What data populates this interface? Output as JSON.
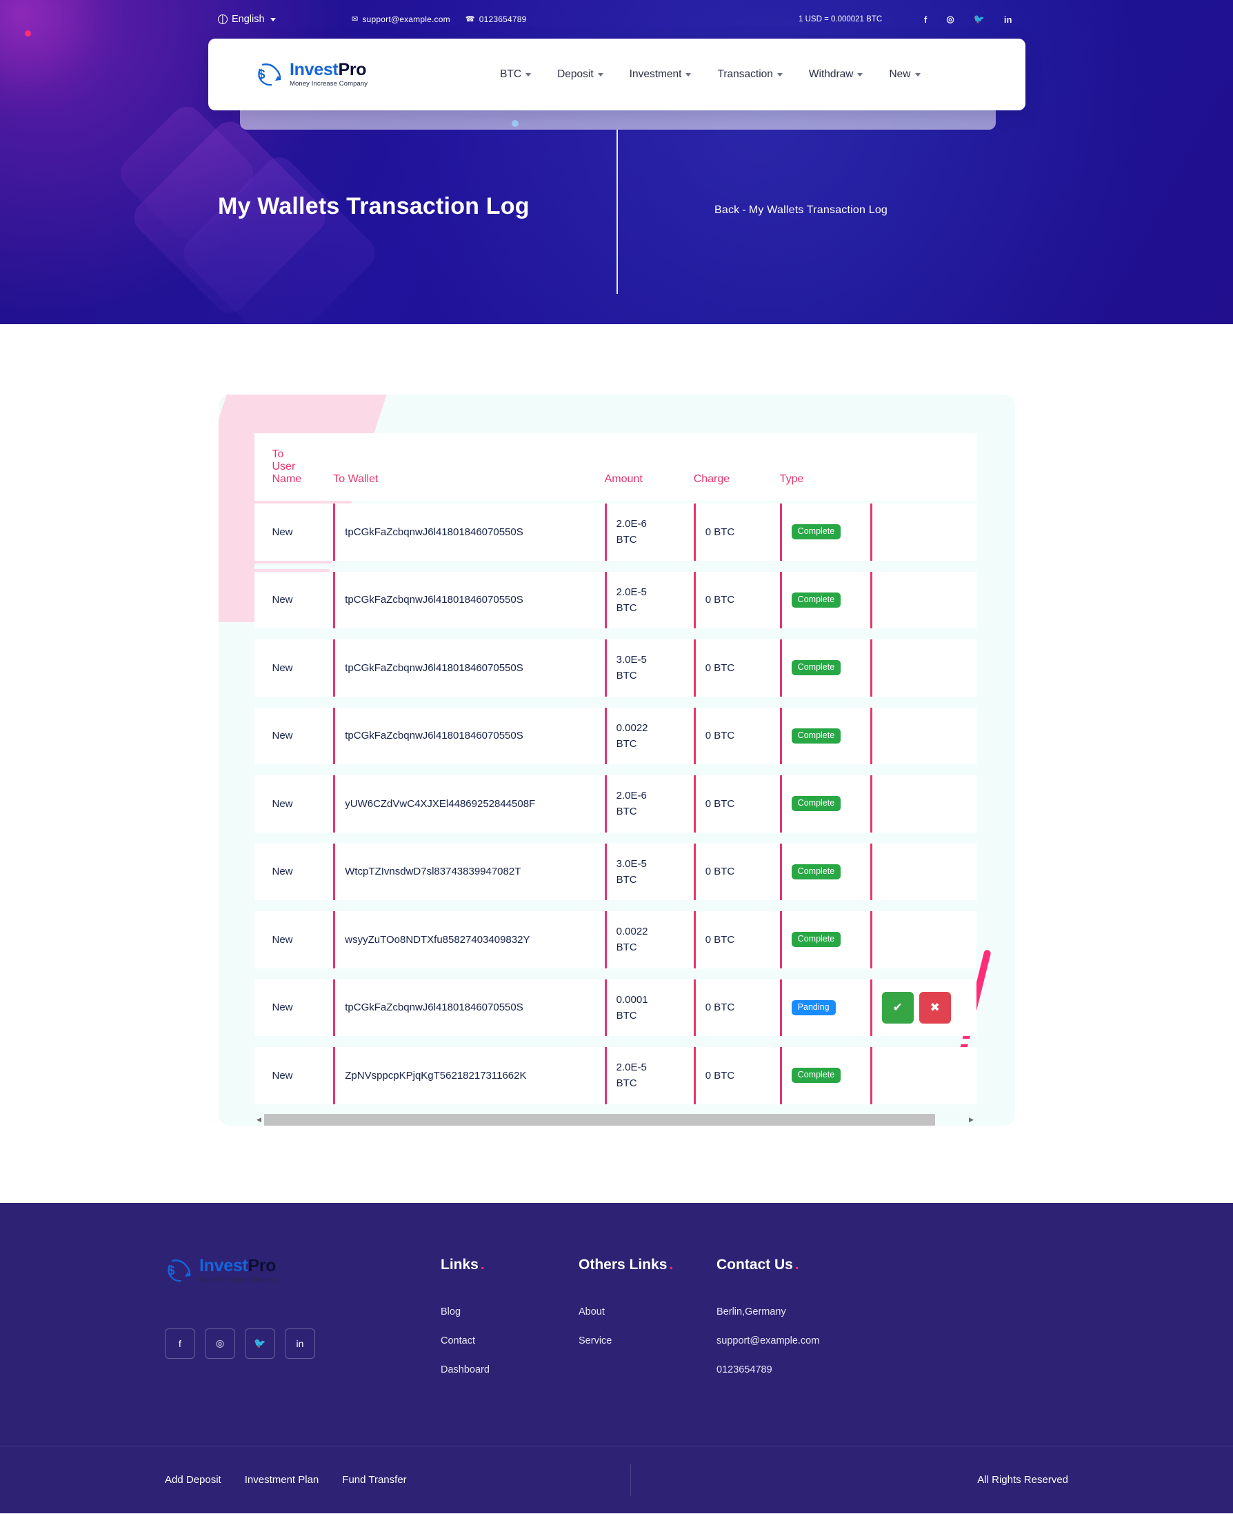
{
  "topbar": {
    "language": "English",
    "language_icon": "globe-icon",
    "caret_icon": "chevron-down-icon",
    "email": "support@example.com",
    "email_icon": "mail-icon",
    "phone": "0123654789",
    "phone_icon": "phone-icon",
    "rate": "1 USD = 0.000021 BTC",
    "social": [
      {
        "name": "facebook-icon",
        "glyph": "f"
      },
      {
        "name": "instagram-icon",
        "glyph": "◎"
      },
      {
        "name": "twitter-icon",
        "glyph": "🐦"
      },
      {
        "name": "linkedin-icon",
        "glyph": "in"
      }
    ]
  },
  "brand": {
    "name_1": "Invest",
    "name_2": "Pro",
    "tagline": "Money Increase Company"
  },
  "nav": {
    "items": [
      {
        "label": "BTC"
      },
      {
        "label": "Deposit"
      },
      {
        "label": "Investment"
      },
      {
        "label": "Transaction"
      },
      {
        "label": "Withdraw"
      },
      {
        "label": "New"
      }
    ]
  },
  "hero": {
    "title": "My Wallets Transaction Log",
    "crumb_back": "Back",
    "crumb_sep": "-",
    "crumb_current": "My Wallets Transaction Log"
  },
  "table": {
    "headers": {
      "user_line1": "To",
      "user_line2": "User",
      "user_line3": "Name",
      "wallet": "To Wallet",
      "amount": "Amount",
      "charge": "Charge",
      "type": "Type"
    },
    "rows": [
      {
        "user": "New",
        "wallet": "tpCGkFaZcbqnwJ6l41801846070550S",
        "amount_value": "2.0E-6",
        "amount_unit": "BTC",
        "charge": "0 BTC",
        "type": "Complete",
        "type_state": "complete",
        "has_actions": false
      },
      {
        "user": "New",
        "wallet": "tpCGkFaZcbqnwJ6l41801846070550S",
        "amount_value": "2.0E-5",
        "amount_unit": "BTC",
        "charge": "0 BTC",
        "type": "Complete",
        "type_state": "complete",
        "has_actions": false
      },
      {
        "user": "New",
        "wallet": "tpCGkFaZcbqnwJ6l41801846070550S",
        "amount_value": "3.0E-5",
        "amount_unit": "BTC",
        "charge": "0 BTC",
        "type": "Complete",
        "type_state": "complete",
        "has_actions": false
      },
      {
        "user": "New",
        "wallet": "tpCGkFaZcbqnwJ6l41801846070550S",
        "amount_value": "0.0022",
        "amount_unit": "BTC",
        "charge": "0 BTC",
        "type": "Complete",
        "type_state": "complete",
        "has_actions": false
      },
      {
        "user": "New",
        "wallet": "yUW6CZdVwC4XJXEl44869252844508F",
        "amount_value": "2.0E-6",
        "amount_unit": "BTC",
        "charge": "0 BTC",
        "type": "Complete",
        "type_state": "complete",
        "has_actions": false
      },
      {
        "user": "New",
        "wallet": "WtcpTZIvnsdwD7sl83743839947082T",
        "amount_value": "3.0E-5",
        "amount_unit": "BTC",
        "charge": "0 BTC",
        "type": "Complete",
        "type_state": "complete",
        "has_actions": false
      },
      {
        "user": "New",
        "wallet": "wsyyZuTOo8NDTXfu85827403409832Y",
        "amount_value": "0.0022",
        "amount_unit": "BTC",
        "charge": "0 BTC",
        "type": "Complete",
        "type_state": "complete",
        "has_actions": false
      },
      {
        "user": "New",
        "wallet": "tpCGkFaZcbqnwJ6l41801846070550S",
        "amount_value": "0.0001",
        "amount_unit": "BTC",
        "charge": "0 BTC",
        "type": "Panding",
        "type_state": "pending",
        "has_actions": true
      },
      {
        "user": "New",
        "wallet": "ZpNVsppcpKPjqKgT56218217311662K",
        "amount_value": "2.0E-5",
        "amount_unit": "BTC",
        "charge": "0 BTC",
        "type": "Complete",
        "type_state": "complete",
        "has_actions": false
      }
    ],
    "actions": {
      "approve_glyph": "✔",
      "reject_glyph": "✖"
    },
    "scrollbar": {
      "left_arrow": "◀",
      "right_arrow": "▶"
    }
  },
  "footer": {
    "links_title": "Links",
    "links": [
      {
        "label": "Blog"
      },
      {
        "label": "Contact"
      },
      {
        "label": "Dashboard"
      }
    ],
    "others_title": "Others Links",
    "others": [
      {
        "label": "About"
      },
      {
        "label": "Service"
      }
    ],
    "contact_title": "Contact Us",
    "contact": [
      {
        "label": "Berlin,Germany"
      },
      {
        "label": "support@example.com"
      },
      {
        "label": "0123654789"
      }
    ],
    "bottom_links": [
      {
        "label": "Add Deposit"
      },
      {
        "label": "Investment Plan"
      },
      {
        "label": "Fund Transfer"
      }
    ],
    "rights": "All Rights Reserved"
  },
  "colors": {
    "brand_blue": "#1565d8",
    "accent_pink": "#e5356c",
    "hero_purple": "#21139b",
    "footer_purple": "#2e2274",
    "status_complete": "#28a745",
    "status_pending": "#1a8cff",
    "approve_green": "#36a544",
    "reject_red": "#e0434f"
  }
}
